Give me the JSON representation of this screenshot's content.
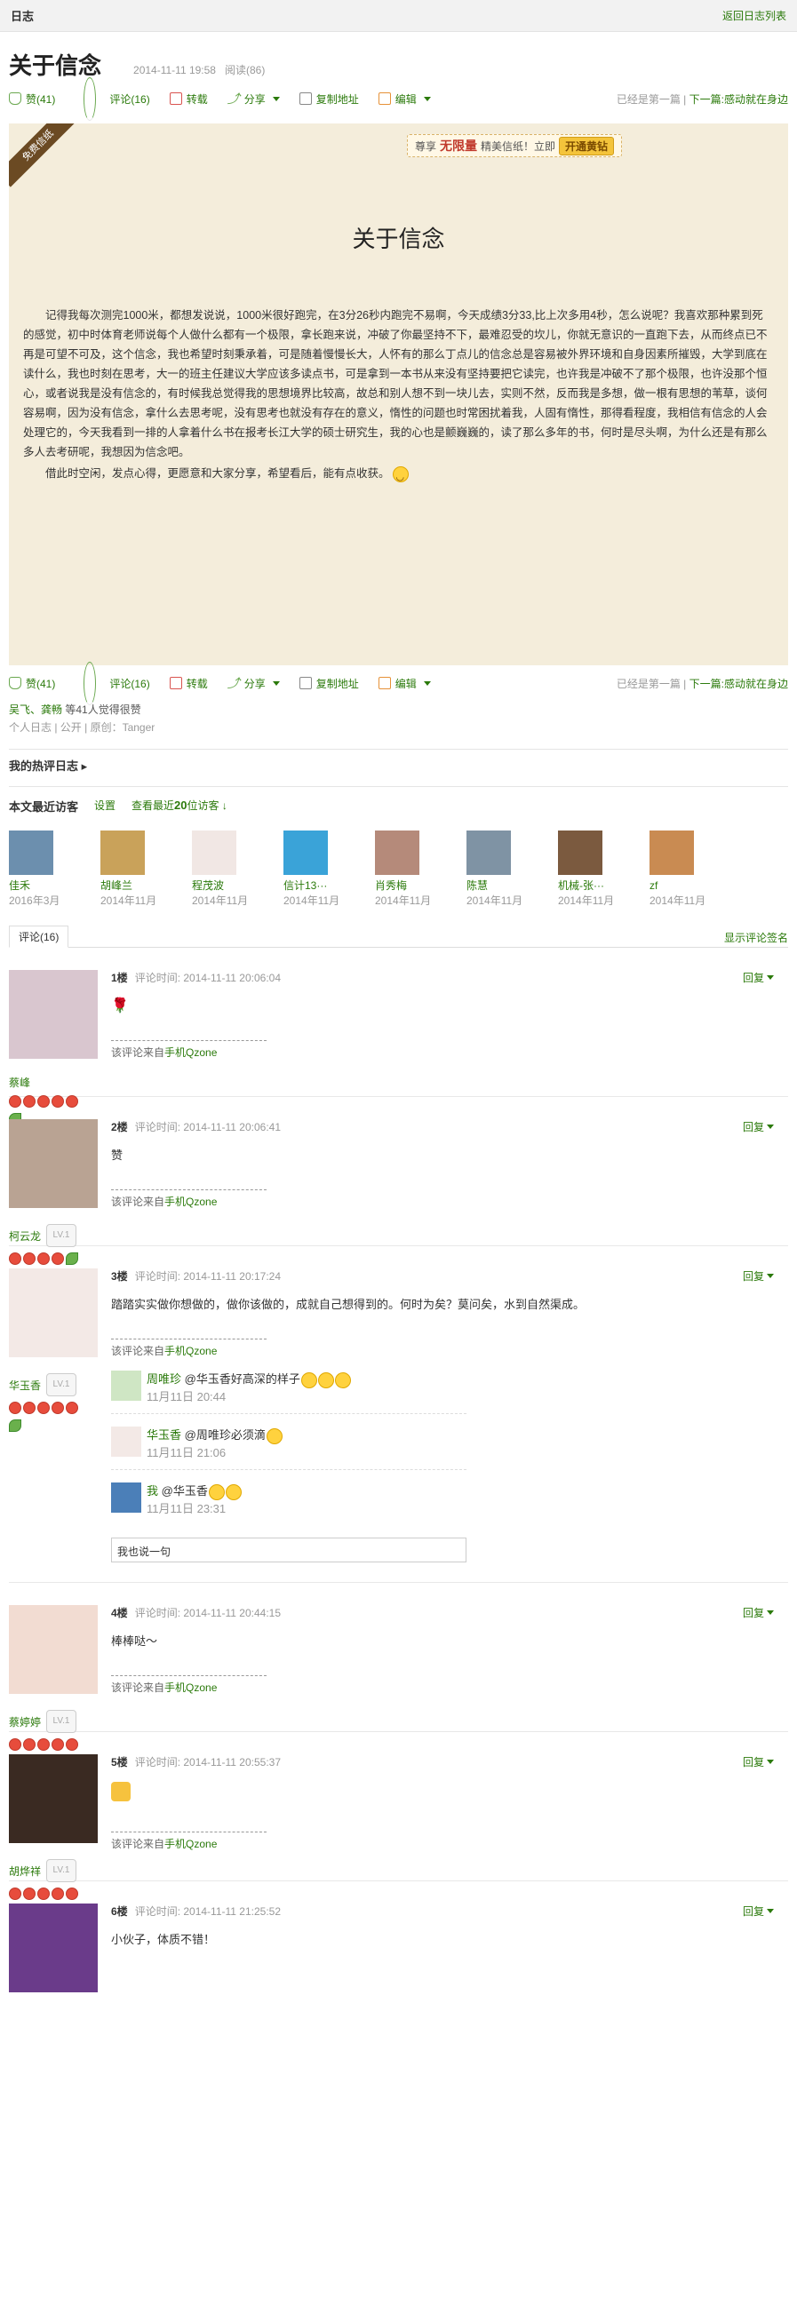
{
  "topbar": {
    "title": "日志",
    "back": "返回日志列表"
  },
  "post": {
    "title": "关于信念",
    "date": "2014-11-11 19:58",
    "reads": "阅读(86)",
    "actions": {
      "like": "赞(41)",
      "comment": "评论(16)",
      "repost": "转载",
      "share": "分享",
      "copy": "复制地址",
      "edit": "编辑"
    },
    "nav": {
      "first": "已经是第一篇",
      "sep": "|",
      "next_label": "下一篇:",
      "next": "感动就在身边"
    },
    "ribbon": "免费信纸",
    "promo": {
      "pre": "尊享",
      "bold": "无限量",
      "post": "精美信纸！立即",
      "btn": "开通黄钻"
    },
    "letter_title": "关于信念",
    "paragraph1": "记得我每次测完1000米，都想发说说，1000米很好跑完，在3分26秒内跑完不易啊，今天成绩3分33,比上次多用4秒，怎么说呢？我喜欢那种累到死的感觉，初中时体育老师说每个人做什么都有一个极限，拿长跑来说，冲破了你最坚持不下，最难忍受的坎儿，你就无意识的一直跑下去，从而终点已不再是可望不可及，这个信念，我也希望时刻秉承着，可是随着慢慢长大，人怀有的那么丁点儿的信念总是容易被外界环境和自身因素所摧毁，大学到底在读什么，我也时刻在思考，大一的班主任建议大学应该多读点书，可是拿到一本书从来没有坚持要把它读完，也许我是冲破不了那个极限，也许没那个恒心，或者说我是没有信念的，有时候我总觉得我的思想境界比较高，故总和别人想不到一块儿去，实则不然，反而我是多想，做一根有思想的苇草，谈何容易啊，因为没有信念，拿什么去思考呢，没有思考也就没有存在的意义，惰性的问题也时常困扰着我，人固有惰性，那得看程度，我相信有信念的人会处理它的，今天我看到一排的人拿着什么书在报考长江大学的硕士研究生，我的心也是颤巍巍的，读了那么多年的书，何时是尽头啊，为什么还是有那么多人去考研呢，我想因为信念吧。",
    "paragraph2": "借此时空闲，发点心得，更愿意和大家分享，希望看后，能有点收获。",
    "likes": {
      "names": "吴飞、龚畅",
      "rest": "等41人觉得很赞"
    },
    "tags": "个人日志 | 公开 | 原创：Tanger"
  },
  "hot": "我的热评日志",
  "visitors": {
    "title": "本文最近访客",
    "settings": "设置",
    "view_prefix": "查看最近",
    "view_count": "20",
    "view_suffix": "位访客",
    "list": [
      {
        "name": "佳禾",
        "date": "2016年3月"
      },
      {
        "name": "胡峰兰",
        "date": "2014年11月"
      },
      {
        "name": "程茂波",
        "date": "2014年11月"
      },
      {
        "name": "信计13···",
        "date": "2014年11月"
      },
      {
        "name": "肖秀梅",
        "date": "2014年11月"
      },
      {
        "name": "陈慧",
        "date": "2014年11月"
      },
      {
        "name": "机械-张···",
        "date": "2014年11月"
      },
      {
        "name": "zf",
        "date": "2014年11月"
      }
    ]
  },
  "comments_tab": {
    "label": "评论(16)",
    "show_sig": "显示评论签名"
  },
  "comments": [
    {
      "floor": "1楼",
      "time": "评论时间: 2014-11-11 20:06:04",
      "name": "蔡峰",
      "text": "",
      "src_pre": "该评论来自",
      "src": "手机Qzone",
      "reply": "回复"
    },
    {
      "floor": "2楼",
      "time": "评论时间: 2014-11-11 20:06:41",
      "name": "柯云龙",
      "text": "赞",
      "src_pre": "该评论来自",
      "src": "手机Qzone",
      "reply": "回复"
    },
    {
      "floor": "3楼",
      "time": "评论时间: 2014-11-11 20:17:24",
      "name": "华玉香",
      "text": "踏踏实实做你想做的，做你该做的，成就自己想得到的。何时为矣？莫问矣，水到自然渠成。",
      "src_pre": "该评论来自",
      "src": "手机Qzone",
      "reply": "回复"
    },
    {
      "floor": "4楼",
      "time": "评论时间: 2014-11-11 20:44:15",
      "name": "蔡婷婷",
      "text": "棒棒哒～",
      "src_pre": "该评论来自",
      "src": "手机Qzone",
      "reply": "回复"
    },
    {
      "floor": "5楼",
      "time": "评论时间: 2014-11-11 20:55:37",
      "name": "胡烨祥",
      "text": "",
      "src_pre": "该评论来自",
      "src": "手机Qzone",
      "reply": "回复"
    },
    {
      "floor": "6楼",
      "time": "评论时间: 2014-11-11 21:25:52",
      "name": "",
      "text": "小伙子，体质不错！",
      "src_pre": "",
      "src": "",
      "reply": "回复"
    }
  ],
  "subreplies": [
    {
      "name": "周唯珍",
      "text": "@华玉香好高深的样子",
      "when": "11月11日 20:44"
    },
    {
      "name": "华玉香",
      "text": "@周唯珍必须滴",
      "when": "11月11日 21:06"
    },
    {
      "name": "我",
      "text": "@华玉香",
      "when": "11月11日 23:31"
    }
  ],
  "reply_input": "我也说一句",
  "level_badge": "LV.1"
}
